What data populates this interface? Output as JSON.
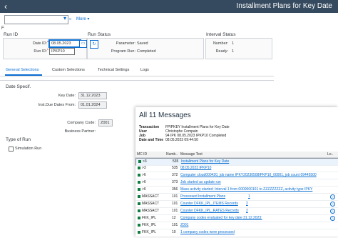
{
  "header": {
    "back_icon": "‹",
    "title": "Installment Plans for Key Date"
  },
  "toolbar": {
    "more_label": "More"
  },
  "run_id": {
    "section_label": "Run ID",
    "date_id_label": "Date ID:",
    "date_id_value": "08.05.2023",
    "run_id_label": "Run ID:",
    "run_id_value": "IPKP10"
  },
  "run_status": {
    "section_label": "Run Status",
    "parameter_label": "Parameter:",
    "parameter_value": "Saved",
    "program_run_label": "Program Run:",
    "program_run_value": "Completed"
  },
  "interval_status": {
    "section_label": "Interval Status",
    "number_label": "Number:",
    "number_value": "1",
    "ready_label": "Ready:",
    "ready_value": "1"
  },
  "tabs": [
    {
      "label": "General Selections"
    },
    {
      "label": "Custom Selections"
    },
    {
      "label": "Technical Settings"
    },
    {
      "label": "Logs"
    }
  ],
  "general": {
    "date_specif_label": "Date Specif.",
    "key_date_label": "Key Date:",
    "key_date_value": "31.12.2023",
    "inst_due_label": "Inst.Due Dates From:",
    "inst_due_value": "01.01.2024",
    "company_code_label": "Company Code:",
    "company_code_value": "Z001",
    "business_partner_label": "Business Partner:",
    "type_of_run_label": "Type of Run",
    "simulation_run_label": "Simulation Run"
  },
  "messages": {
    "title": "All 11 Messages",
    "info": [
      {
        "label": "Transaction",
        "value": "FPIPKEY Installment Plans for Key Date"
      },
      {
        "label": "User",
        "value": "Christophe Compain"
      },
      {
        "label": "Job",
        "value": "94 IPK 08.05.2023 IPKP10 Completed"
      },
      {
        "label": "Date and Time",
        "value": "08.05.2023 09:44:50"
      }
    ],
    "columns": [
      "MC ID",
      "Numb..",
      "Message Text",
      "Lo.."
    ],
    "rows": [
      {
        "mcid": ">3",
        "num": "535",
        "text": "Installment Plans for Key Date",
        "link": true,
        "info": false
      },
      {
        "mcid": ">3",
        "num": "535",
        "text": "08.05.2023 IPKP10",
        "link": true,
        "info": false
      },
      {
        "mcid": ">6",
        "num": "372",
        "text": "Computer cloud000420, job name IPKY20230508IPKP10_00001, job count 09445500",
        "link": true,
        "info": false
      },
      {
        "mcid": ">6",
        "num": "373",
        "text": "Job started as update run",
        "link": true,
        "info": false
      },
      {
        "mcid": ">6",
        "num": "356",
        "text": "Mass activity started: Interval 1 from 0000000101 to ZZZZZZZZZ, activity type IPKY",
        "link": true,
        "info": false
      },
      {
        "mcid": "MASSACT",
        "num": "101",
        "text": "Processed Installment Plans",
        "count": "1",
        "link": true,
        "info": true
      },
      {
        "mcid": "MASSACT",
        "num": "101",
        "text": "Counter DFKK_IPL_ITEMS Records",
        "count": "2",
        "link": true,
        "info": true
      },
      {
        "mcid": "MASSACT",
        "num": "101",
        "text": "Counter DFKK_IPL_RATES Records",
        "count": "2",
        "link": true,
        "info": true
      },
      {
        "mcid": "FKK_IPL",
        "num": "12",
        "text": "Company codes evaluated for key date 31.12.2023:",
        "link": true,
        "info": true
      },
      {
        "mcid": "FKK_IPL",
        "num": "101",
        "text": "Z001",
        "link": true,
        "info": false
      },
      {
        "mcid": "FKK_IPL",
        "num": "10",
        "text": "1 company codes were processed",
        "link": true,
        "info": false
      }
    ]
  },
  "colors": {
    "shell": "#354a5f",
    "accent": "#0a6ed1",
    "success": "#107e3e"
  }
}
